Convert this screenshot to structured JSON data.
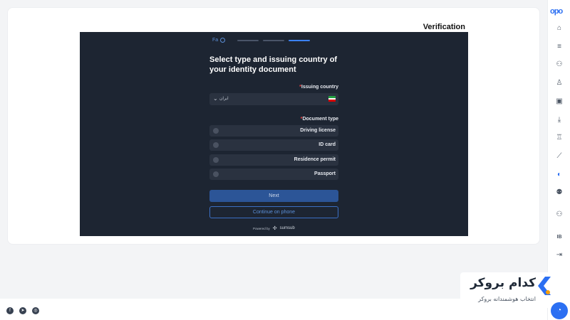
{
  "page": {
    "title": "Verification"
  },
  "sumsub": {
    "lang": "Fa",
    "heading": "Select type and issuing country of your identity document",
    "issuing_country_label": "Issuing country",
    "issuing_country_value": "ایران",
    "document_type_label": "Document type",
    "options": [
      {
        "label": "Driving license"
      },
      {
        "label": "ID card"
      },
      {
        "label": "Residence permit"
      },
      {
        "label": "Passport"
      }
    ],
    "next_label": "Next",
    "continue_phone_label": "Continue on phone",
    "powered_by": "Powered by",
    "powered_brand": "sumsub"
  },
  "sidebar": {
    "logo": "opo",
    "items": [
      {
        "icon": "home-icon"
      },
      {
        "icon": "filter-icon"
      },
      {
        "icon": "users-icon"
      },
      {
        "icon": "user-icon"
      },
      {
        "icon": "wallet-icon"
      },
      {
        "icon": "download-icon"
      },
      {
        "icon": "trophy-icon"
      },
      {
        "icon": "chart-icon"
      },
      {
        "icon": "brand-icon"
      },
      {
        "icon": "partners-icon"
      },
      {
        "icon": "team-icon"
      },
      {
        "icon": "ib-icon",
        "label": "IB"
      },
      {
        "icon": "logout-icon"
      }
    ]
  },
  "watermark": {
    "title": "کدام بروکر",
    "subtitle": "انتخاب هوشمندانه بروکر"
  },
  "colors": {
    "accent": "#2b6ff2",
    "frame_bg": "#1d2532",
    "required": "#ef4444"
  }
}
